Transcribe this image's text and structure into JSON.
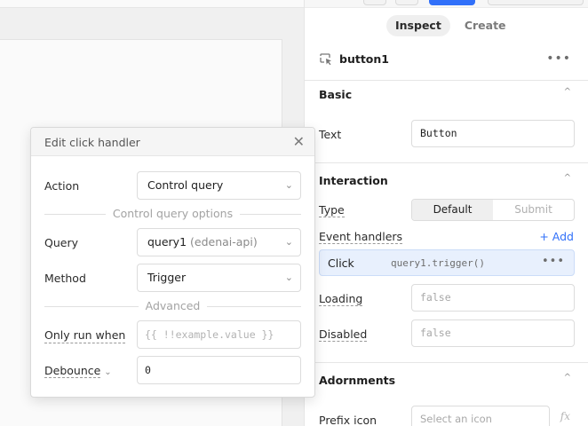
{
  "panel": {
    "tabs": [
      {
        "label": "Inspect",
        "active": true
      },
      {
        "label": "Create",
        "active": false
      }
    ],
    "component_name": "button1",
    "more_glyph": "•••",
    "sections": {
      "basic": {
        "title": "Basic",
        "text_label": "Text",
        "text_value": "Button"
      },
      "interaction": {
        "title": "Interaction",
        "type_label": "Type",
        "type_options": [
          "Default",
          "Submit"
        ],
        "type_selected": "Default",
        "event_handlers_label": "Event handlers",
        "add_label": "+ Add",
        "handler": {
          "event": "Click",
          "action": "query1.trigger()"
        },
        "loading_label": "Loading",
        "loading_placeholder": "false",
        "disabled_label": "Disabled",
        "disabled_placeholder": "false"
      },
      "adornments": {
        "title": "Adornments",
        "prefix_icon_label": "Prefix icon",
        "prefix_icon_placeholder": "Select an icon",
        "fx_label": "fx"
      }
    }
  },
  "popover": {
    "title": "Edit click handler",
    "close_glyph": "✕",
    "action_label": "Action",
    "action_value": "Control query",
    "control_query_options_label": "Control query options",
    "query_label": "Query",
    "query_value": "query1",
    "query_resource": "(edenai-api)",
    "method_label": "Method",
    "method_value": "Trigger",
    "advanced_label": "Advanced",
    "only_run_when_label": "Only run when",
    "only_run_when_placeholder": "{{ !!example.value }}",
    "debounce_label": "Debounce",
    "debounce_value": "0"
  },
  "colors": {
    "accent": "#3170f9",
    "handler_bg": "#e8f0fd"
  },
  "icons": {
    "component": "cursor-select-icon",
    "chevron": "chevron-down-icon",
    "caret_up": "caret-up-icon"
  }
}
